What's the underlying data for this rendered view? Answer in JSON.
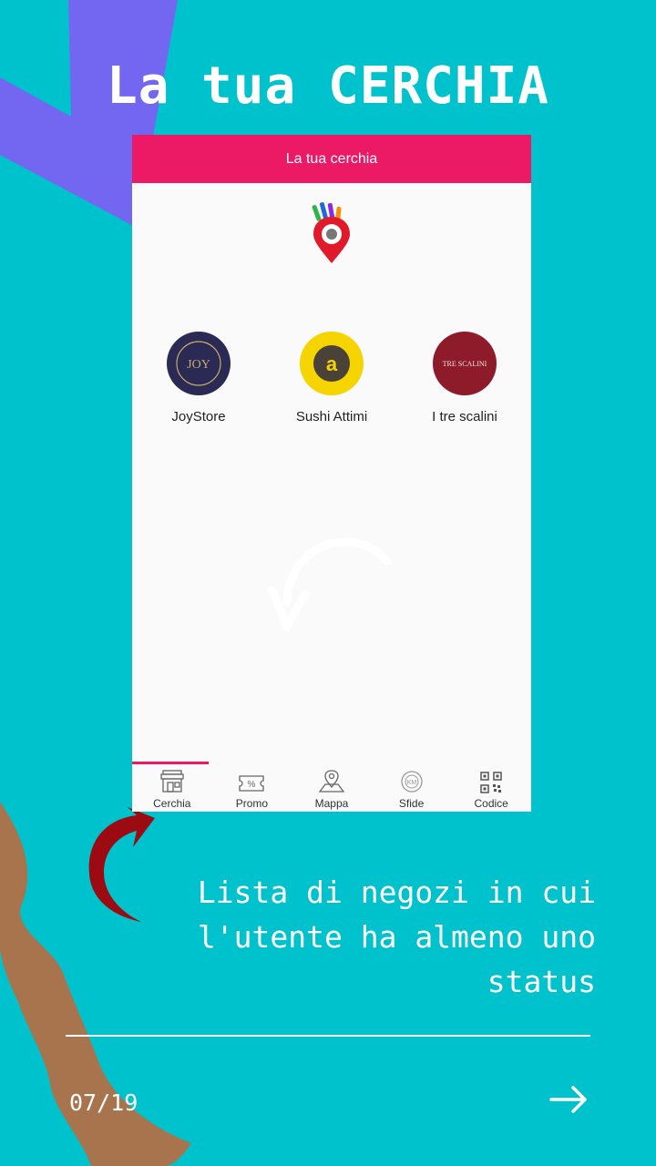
{
  "slide": {
    "title": "La tua CERCHIA",
    "caption_lines": [
      "Lista di negozi in cui",
      "l'utente ha almeno uno",
      "status"
    ],
    "page_indicator": "07/19",
    "next_icon": "arrow-right-icon"
  },
  "app": {
    "header_title": "La tua cerchia",
    "logo": "location-pin-logo",
    "stores": [
      {
        "name": "JoyStore",
        "avatar_text": "JOY",
        "avatar_color": "#2a2a55"
      },
      {
        "name": "Sushi Attimi",
        "avatar_text": "a",
        "avatar_color": "#f5d400"
      },
      {
        "name": "I tre scalini",
        "avatar_text": "TRE SCALINI",
        "avatar_color": "#8e1b2a"
      }
    ],
    "tabs": [
      {
        "label": "Cerchia",
        "icon": "store-icon",
        "active": true
      },
      {
        "label": "Promo",
        "icon": "coupon-icon"
      },
      {
        "label": "Mappa",
        "icon": "map-pin-icon"
      },
      {
        "label": "Sfide",
        "icon": "challenge-icon"
      },
      {
        "label": "Codice",
        "icon": "qr-code-icon"
      }
    ]
  },
  "colors": {
    "background": "#00c2cc",
    "accent": "#ec1a64",
    "purple": "#7366f0",
    "brown": "#a8744e",
    "dark_red": "#9c0a12"
  }
}
